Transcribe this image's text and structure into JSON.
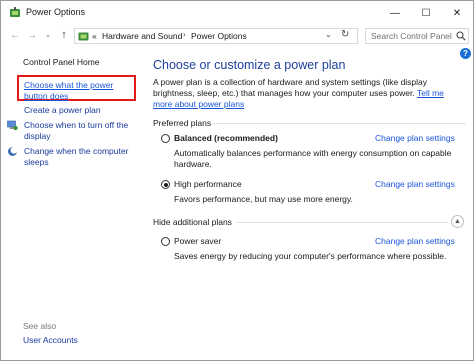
{
  "window": {
    "title": "Power Options",
    "controls": {
      "minimize": "—",
      "maximize": "☐",
      "close": "✕"
    }
  },
  "nav": {
    "back": "←",
    "forward": "→",
    "recent": "⌄",
    "up": "↑",
    "breadcrumb_prefix": "«",
    "breadcrumb": [
      "Hardware and Sound",
      "Power Options"
    ],
    "separator": "›",
    "dropdown": "⌄",
    "refresh": "↻",
    "search_placeholder": "Search Control Panel"
  },
  "sidebar": {
    "home": "Control Panel Home",
    "links": [
      "Choose what the power button does",
      "Create a power plan",
      "Choose when to turn off the display",
      "Change when the computer sleeps"
    ],
    "see_also": "See also",
    "user_accounts": "User Accounts"
  },
  "main": {
    "help": "?",
    "title": "Choose or customize a power plan",
    "description": "A power plan is a collection of hardware and system settings (like display brightness, sleep, etc.) that manages how your computer uses power. ",
    "description_link": "Tell me more about power plans",
    "preferred_label": "Preferred plans",
    "hidden_label": "Hide additional plans",
    "plans": [
      {
        "name": "Balanced (recommended)",
        "change": "Change plan settings",
        "desc": "Automatically balances performance with energy consumption on capable hardware.",
        "checked": false
      },
      {
        "name": "High performance",
        "change": "Change plan settings",
        "desc": "Favors performance, but may use more energy.",
        "checked": true
      },
      {
        "name": "Power saver",
        "change": "Change plan settings",
        "desc": "Saves energy by reducing your computer's performance where possible.",
        "checked": false
      }
    ]
  },
  "colors": {
    "link": "#1a55d8",
    "heading": "#1e3f9b",
    "highlight": "#e11b1b"
  }
}
